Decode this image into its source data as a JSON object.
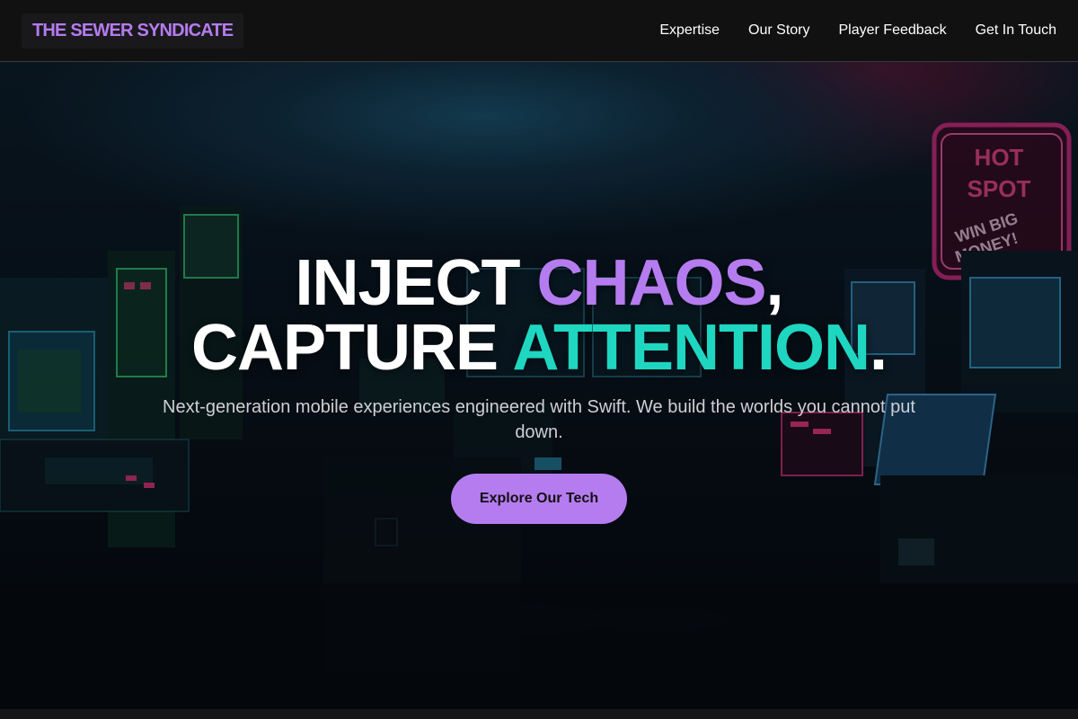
{
  "brand": {
    "name": "THE SEWER SYNDICATE"
  },
  "nav": {
    "items": [
      {
        "label": "Expertise"
      },
      {
        "label": "Our Story"
      },
      {
        "label": "Player Feedback"
      },
      {
        "label": "Get In Touch"
      }
    ]
  },
  "hero": {
    "headline_line1_a": "INJECT ",
    "headline_line1_b": "CHAOS",
    "headline_line1_c": ",",
    "headline_line2_a": "CAPTURE ",
    "headline_line2_b": "ATTENTION",
    "headline_line2_c": ".",
    "subtitle": "Next-generation mobile experiences engineered with Swift. We build the worlds you cannot put down.",
    "cta_label": "Explore Our Tech",
    "sign_text_1": "HOT",
    "sign_text_2": "SPOT",
    "sign_text_3": "WIN BIG",
    "sign_text_4": "MONEY!"
  },
  "colors": {
    "accent_purple": "#b57cf0",
    "accent_teal": "#1fd6c1",
    "nav_bg": "#111112"
  }
}
